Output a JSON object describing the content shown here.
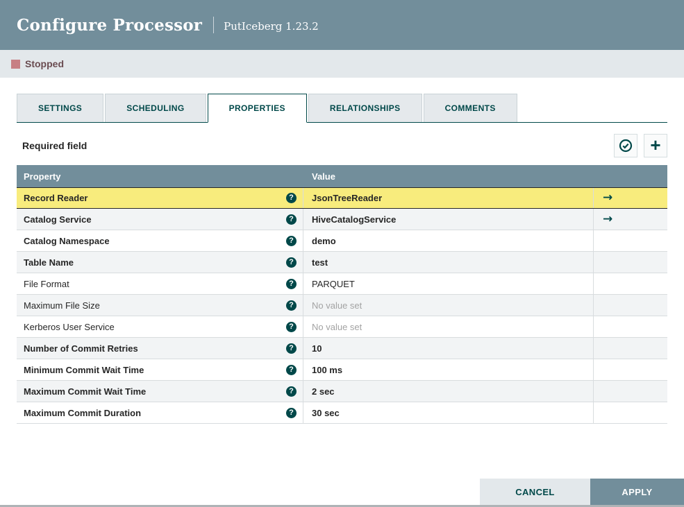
{
  "header": {
    "title": "Configure Processor",
    "subtitle": "PutIceberg 1.23.2"
  },
  "status": {
    "label": "Stopped",
    "state_color": "#C77F84"
  },
  "tabs": [
    {
      "label": "SETTINGS",
      "active": false
    },
    {
      "label": "SCHEDULING",
      "active": false
    },
    {
      "label": "PROPERTIES",
      "active": true
    },
    {
      "label": "RELATIONSHIPS",
      "active": false
    },
    {
      "label": "COMMENTS",
      "active": false
    }
  ],
  "properties_panel": {
    "required_label": "Required field",
    "toolbar_icons": [
      {
        "name": "verify-properties-icon"
      },
      {
        "name": "add-property-icon"
      }
    ],
    "table": {
      "columns": {
        "property": "Property",
        "value": "Value"
      },
      "rows": [
        {
          "property": "Record Reader",
          "value": "JsonTreeReader",
          "required": true,
          "unset": false,
          "selected": true,
          "has_goto": true
        },
        {
          "property": "Catalog Service",
          "value": "HiveCatalogService",
          "required": true,
          "unset": false,
          "selected": false,
          "has_goto": true
        },
        {
          "property": "Catalog Namespace",
          "value": "demo",
          "required": true,
          "unset": false,
          "selected": false,
          "has_goto": false
        },
        {
          "property": "Table Name",
          "value": "test",
          "required": true,
          "unset": false,
          "selected": false,
          "has_goto": false
        },
        {
          "property": "File Format",
          "value": "PARQUET",
          "required": false,
          "unset": false,
          "selected": false,
          "has_goto": false
        },
        {
          "property": "Maximum File Size",
          "value": "No value set",
          "required": false,
          "unset": true,
          "selected": false,
          "has_goto": false
        },
        {
          "property": "Kerberos User Service",
          "value": "No value set",
          "required": false,
          "unset": true,
          "selected": false,
          "has_goto": false
        },
        {
          "property": "Number of Commit Retries",
          "value": "10",
          "required": true,
          "unset": false,
          "selected": false,
          "has_goto": false
        },
        {
          "property": "Minimum Commit Wait Time",
          "value": "100 ms",
          "required": true,
          "unset": false,
          "selected": false,
          "has_goto": false
        },
        {
          "property": "Maximum Commit Wait Time",
          "value": "2 sec",
          "required": true,
          "unset": false,
          "selected": false,
          "has_goto": false
        },
        {
          "property": "Maximum Commit Duration",
          "value": "30 sec",
          "required": true,
          "unset": false,
          "selected": false,
          "has_goto": false
        }
      ],
      "help_glyph": "?",
      "goto_glyph": "→"
    }
  },
  "footer": {
    "cancel_label": "CANCEL",
    "apply_label": "APPLY"
  },
  "colors": {
    "header_bg": "#728E9B",
    "accent_teal": "#004849",
    "status_bar_bg": "#E3E8EB",
    "selected_row_bg": "#F8EC7D",
    "alt_row_bg": "#F2F4F5",
    "unset_value_text": "#A3A3A3"
  }
}
